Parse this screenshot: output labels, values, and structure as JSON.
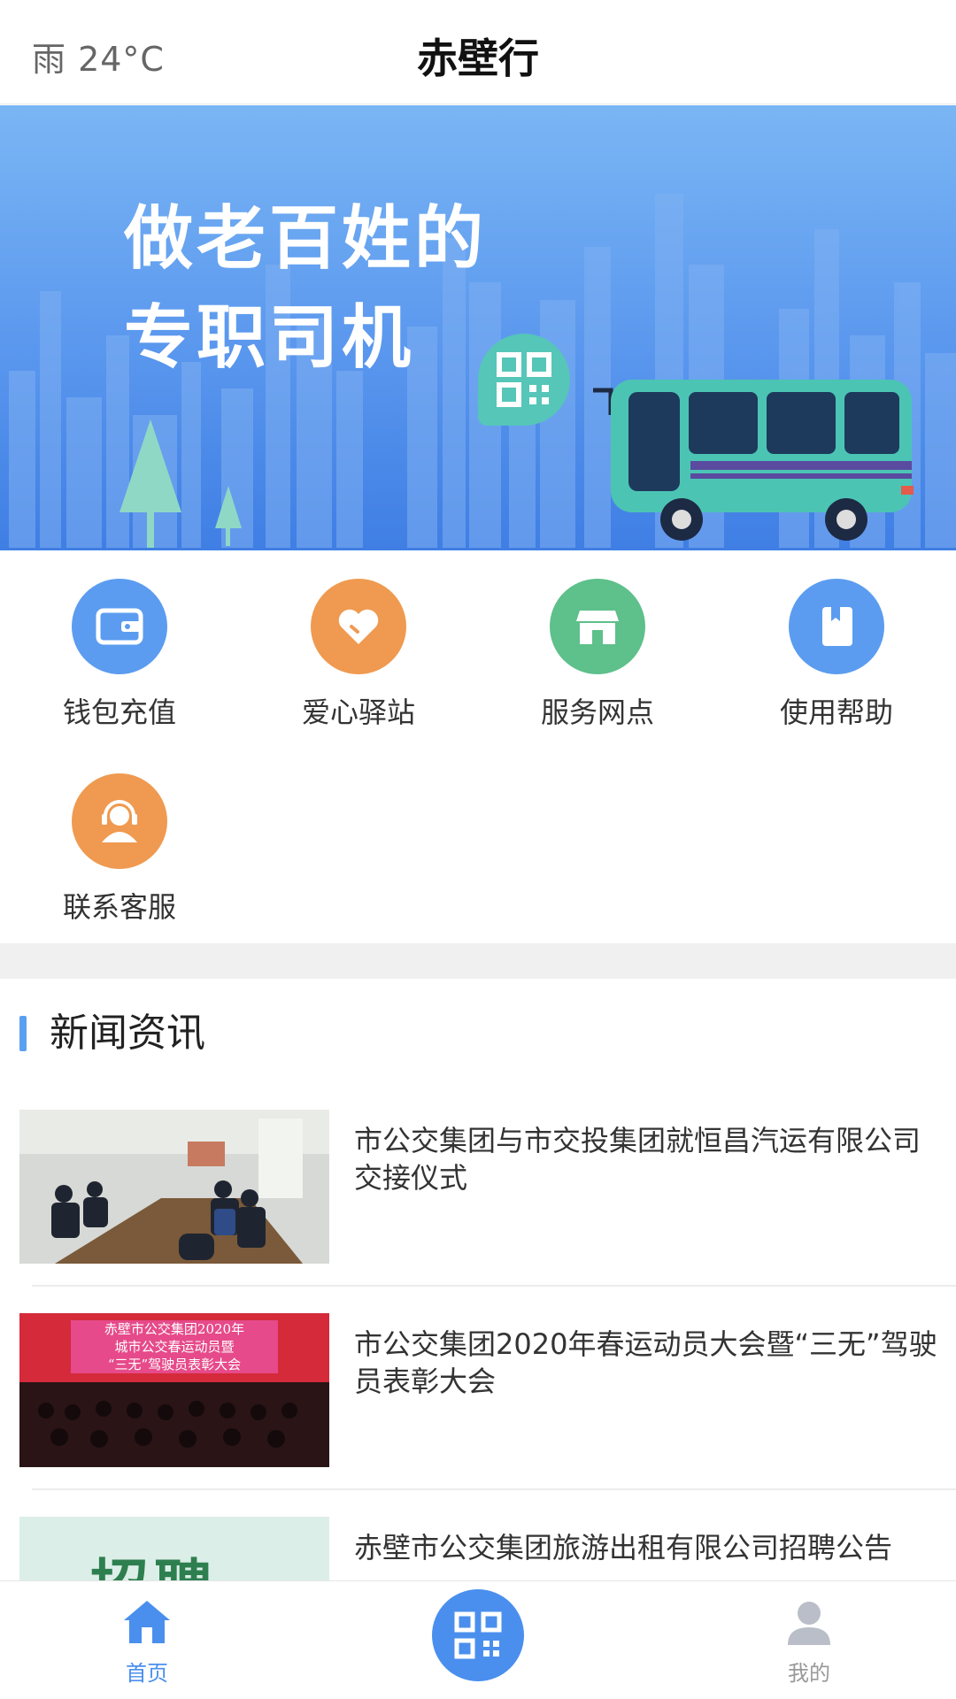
{
  "header": {
    "weather": "雨  24°C",
    "title": "赤壁行"
  },
  "banner": {
    "slogan_line1": "做老百姓的",
    "slogan_line2": "专职司机"
  },
  "quick_actions": [
    {
      "label": "钱包充值",
      "icon": "wallet-icon",
      "color": "#5b9cf0"
    },
    {
      "label": "爱心驿站",
      "icon": "heart-icon",
      "color": "#ef9a50"
    },
    {
      "label": "服务网点",
      "icon": "store-icon",
      "color": "#5ec08a"
    },
    {
      "label": "使用帮助",
      "icon": "book-icon",
      "color": "#5b9cf0"
    },
    {
      "label": "联系客服",
      "icon": "customer-service-icon",
      "color": "#ef9a50"
    }
  ],
  "news": {
    "section_title": "新闻资讯",
    "items": [
      {
        "title": "市公交集团与市交投集团就恒昌汽运有限公司交接仪式",
        "image": "meeting-photo"
      },
      {
        "title": "市公交集团2020年春运动员大会暨“三无”驾驶员表彰大会",
        "image": "conference-photo",
        "image_banner_line1": "赤壁市公交集团2020年",
        "image_banner_line2": "城市公交春运动员暨",
        "image_banner_line3": "“三无”驾驶员表彰大会"
      },
      {
        "title": "赤壁市公交集团旅游出租有限公司招聘公告",
        "image": "recruitment-poster",
        "image_text": "招聘"
      }
    ]
  },
  "tabbar": {
    "home_label": "首页",
    "home_icon": "home-icon",
    "scan_icon": "qr-scan-icon",
    "mine_label": "我的",
    "mine_icon": "user-icon",
    "active_color": "#4a8fee",
    "inactive_color": "#999999"
  }
}
